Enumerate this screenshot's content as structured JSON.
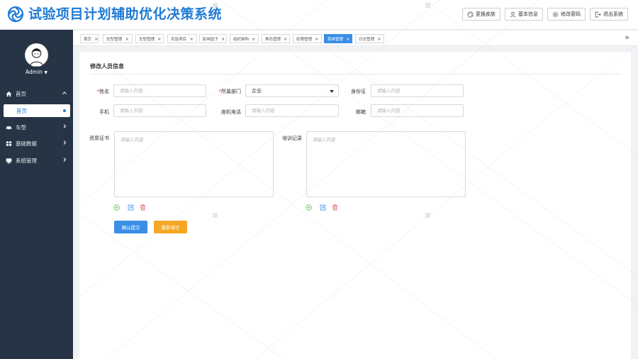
{
  "header": {
    "title": "试验项目计划辅助优化决策系统",
    "buttons": [
      {
        "icon": "palette-icon",
        "label": "更换皮肤"
      },
      {
        "icon": "user-icon",
        "label": "基本信息"
      },
      {
        "icon": "gear-icon",
        "label": "修改密码"
      },
      {
        "icon": "logout-icon",
        "label": "退出系统"
      }
    ]
  },
  "sidebar": {
    "user": "Admin",
    "items": [
      {
        "icon": "home-icon",
        "label": "首页",
        "expanded": true
      },
      {
        "icon": "car-icon",
        "label": "车型",
        "expanded": false
      },
      {
        "icon": "database-icon",
        "label": "基础数据",
        "expanded": false
      },
      {
        "icon": "monitor-icon",
        "label": "系统管理",
        "expanded": false
      }
    ],
    "sub_item": "首页"
  },
  "tabs": {
    "items": [
      "首页",
      "车型管理",
      "车型管理",
      "实验项目",
      "影响因子",
      "组织架构",
      "角色管理",
      "权限管理",
      "菜单管理",
      "日志管理"
    ],
    "active_index": 8,
    "more": "»"
  },
  "form": {
    "title": "修改人员信息",
    "placeholder": "请输入内容",
    "name_label": "姓名",
    "dept_label": "所属部门",
    "dept_value": "企业",
    "idcard_label": "身份证",
    "phone_label": "手机",
    "landline_label": "座机电话",
    "email_label": "邮箱",
    "cert_label": "资质证书",
    "training_label": "培训记录",
    "required_mark": "*",
    "submit_label": "确认提交",
    "reset_label": "重新填写"
  },
  "colors": {
    "brand": "#1e7bd6",
    "sidebar_bg": "#263445",
    "primary_button": "#3a8ee6",
    "warning_button": "#f5a623",
    "add_icon": "#5fb85c",
    "edit_icon": "#3a8ee6",
    "delete_icon": "#e4575b"
  }
}
